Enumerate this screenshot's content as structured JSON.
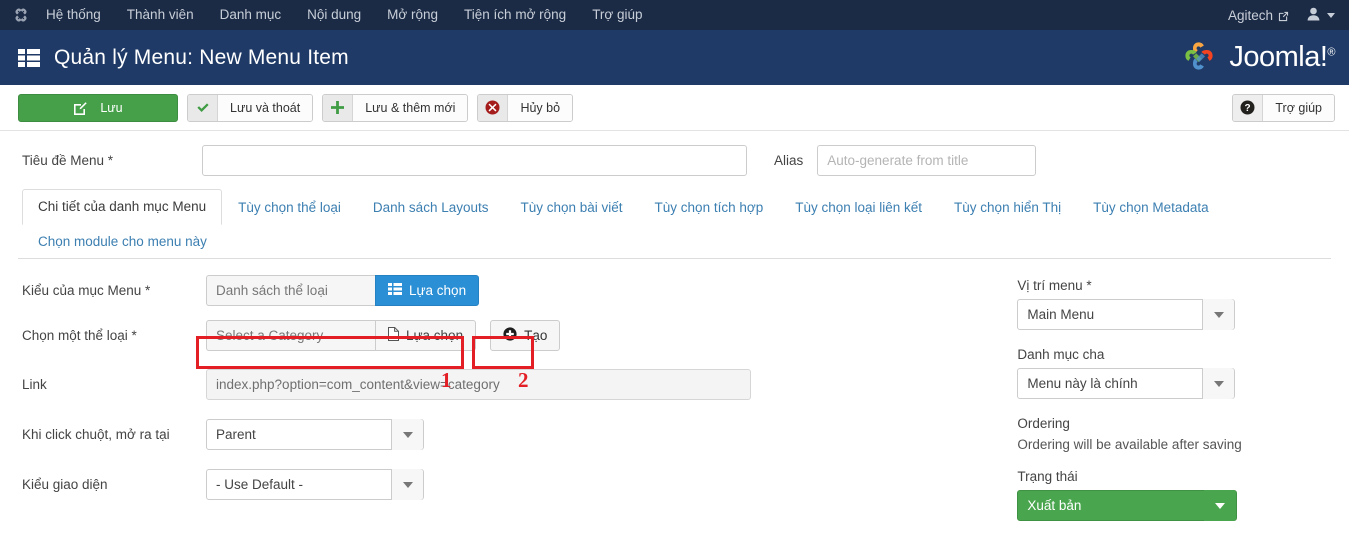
{
  "topnav": {
    "logo_icon": "joomla-mark-icon",
    "items": [
      {
        "label": "Hệ thống"
      },
      {
        "label": "Thành viên"
      },
      {
        "label": "Danh mục"
      },
      {
        "label": "Nội dung"
      },
      {
        "label": "Mở rộng"
      },
      {
        "label": "Tiện ích mở rộng"
      },
      {
        "label": "Trợ giúp"
      }
    ],
    "site_name": "Agitech",
    "site_link_icon": "external-link-icon",
    "user_icon": "user-icon",
    "user_caret_icon": "chevron-down-icon"
  },
  "header": {
    "icon": "menu-list-icon",
    "title": "Quản lý Menu: New Menu Item",
    "brand": "Joomla!",
    "brand_sup": "®",
    "brand_icon": "joomla-logo-icon"
  },
  "toolbar": {
    "save_label": "Lưu",
    "save_icon": "pencil-square-icon",
    "save_close_label": "Lưu và thoát",
    "save_close_icon": "check-icon",
    "save_new_label": "Lưu & thêm mới",
    "save_new_icon": "plus-icon",
    "cancel_label": "Hủy bỏ",
    "cancel_icon": "cancel-circle-icon",
    "help_label": "Trợ giúp",
    "help_icon": "question-circle-icon"
  },
  "form": {
    "title_label": "Tiêu đề Menu *",
    "title_value": "",
    "title_placeholder": "",
    "alias_label": "Alias",
    "alias_value": "",
    "alias_placeholder": "Auto-generate from title"
  },
  "tabs": [
    {
      "label": "Chi tiết của danh mục Menu",
      "active": true
    },
    {
      "label": "Tùy chọn thể loại",
      "active": false
    },
    {
      "label": "Danh sách Layouts",
      "active": false
    },
    {
      "label": "Tùy chọn bài viết",
      "active": false
    },
    {
      "label": "Tùy chọn tích hợp",
      "active": false
    },
    {
      "label": "Tùy chọn loại liên kết",
      "active": false
    },
    {
      "label": "Tùy chọn hiển Thị",
      "active": false
    },
    {
      "label": "Tùy chọn Metadata",
      "active": false
    },
    {
      "label": "Chọn module cho menu này",
      "active": false
    }
  ],
  "main": {
    "menu_type_label": "Kiểu của mục Menu *",
    "menu_type_value": "Danh sách thể loại",
    "menu_type_button": "Lựa chọn",
    "menu_type_button_icon": "list-icon",
    "category_label": "Chọn một thể loại *",
    "category_value": "Select a Category",
    "category_button": "Lựa chọn",
    "category_button_icon": "file-icon",
    "create_button": "Tạo",
    "create_button_icon": "plus-circle-icon",
    "link_label": "Link",
    "link_value": "index.php?option=com_content&view=category",
    "target_label": "Khi click chuột, mở ra tại",
    "target_value": "Parent",
    "template_label": "Kiểu giao diện",
    "template_value": "- Use Default -"
  },
  "sidebar": {
    "menu_location_label": "Vị trí menu *",
    "menu_location_value": "Main Menu",
    "parent_label": "Danh mục cha",
    "parent_value": "Menu này là chính",
    "ordering_label": "Ordering",
    "ordering_text": "Ordering will be available after saving",
    "status_label": "Trạng thái",
    "status_value": "Xuất bản"
  },
  "annotations": [
    {
      "number": "1"
    },
    {
      "number": "2"
    }
  ],
  "colors": {
    "topnav_bg": "#1b2b45",
    "subheader_bg": "#1f3a66",
    "save_green": "#46a04a",
    "pick_blue": "#2a8fd4",
    "status_green": "#4aa64e",
    "annotation_red": "#e31e24",
    "tab_link": "#3c7fb1"
  }
}
